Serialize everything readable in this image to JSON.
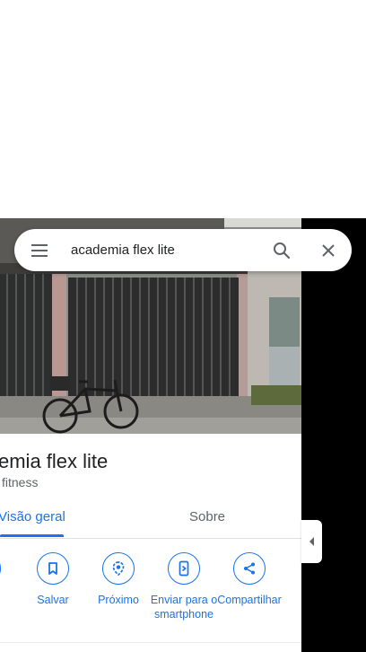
{
  "search": {
    "value": "academia flex lite"
  },
  "place": {
    "title": "emia flex lite",
    "category": "fitness"
  },
  "tabs": {
    "overview": "Visão geral",
    "about": "Sobre"
  },
  "actions": [
    {
      "label": "s",
      "icon": "route-icon"
    },
    {
      "label": "Salvar",
      "icon": "bookmark-icon"
    },
    {
      "label": "Próximo",
      "icon": "nearby-icon"
    },
    {
      "label": "Enviar para o smartphone",
      "icon": "send-to-phone-icon"
    },
    {
      "label": "Compartilhar",
      "icon": "share-icon"
    }
  ],
  "colors": {
    "accent": "#1a73e8",
    "text": "#202124",
    "secondary": "#5f6368"
  }
}
